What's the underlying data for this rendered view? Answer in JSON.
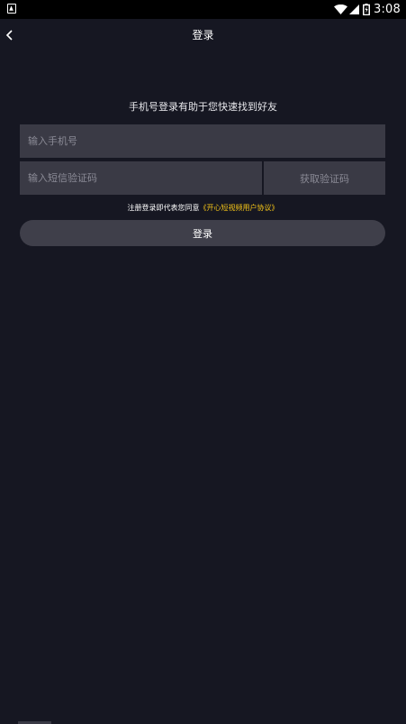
{
  "status_bar": {
    "time": "3:08",
    "left_icon": "notification-a-icon",
    "icons": [
      "wifi-icon",
      "signal-icon",
      "battery-icon"
    ]
  },
  "header": {
    "title": "登录",
    "back_icon": "chevron-left-icon"
  },
  "login": {
    "subtitle": "手机号登录有助于您快速找到好友",
    "phone_placeholder": "输入手机号",
    "code_placeholder": "输入短信验证码",
    "get_code_label": "获取验证码",
    "agreement_prefix": "注册登录即代表您同意",
    "agreement_link": "《开心短视频用户协议》",
    "submit_label": "登录"
  },
  "colors": {
    "background": "#161722",
    "field": "#3a3a45",
    "button": "#3f3f4a",
    "link": "#f5c518"
  }
}
